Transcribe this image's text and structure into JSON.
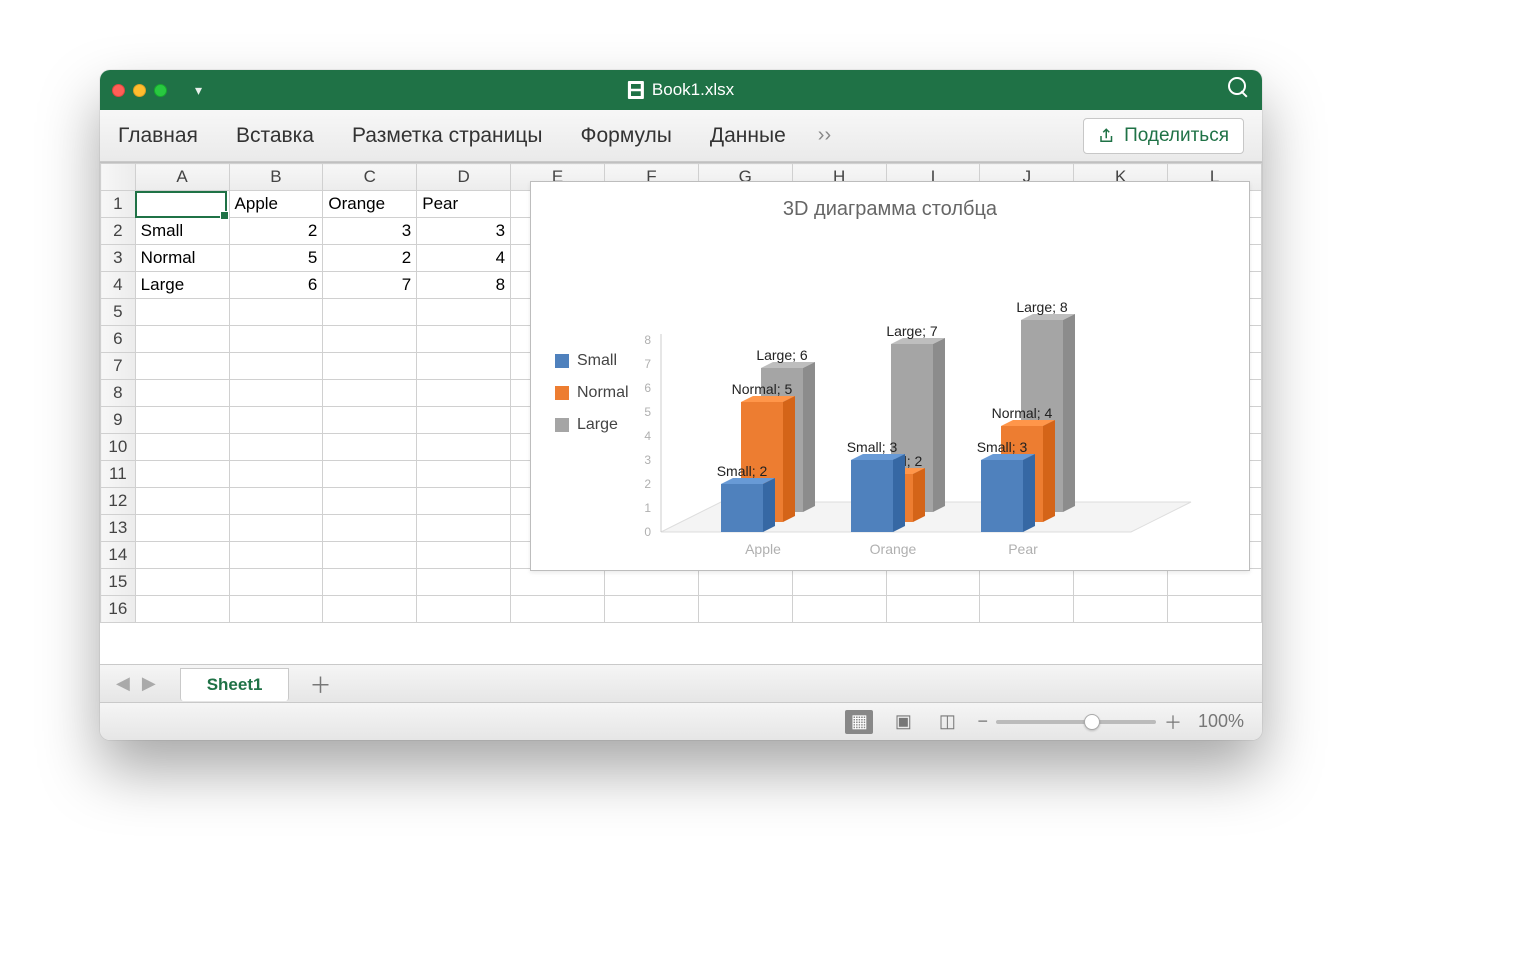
{
  "window": {
    "title": "Book1.xlsx"
  },
  "ribbon": {
    "home": "Главная",
    "insert": "Вставка",
    "layout": "Разметка страницы",
    "formulas": "Формулы",
    "data": "Данные",
    "more": "››",
    "share": "Поделиться"
  },
  "columns": [
    "A",
    "B",
    "C",
    "D",
    "E",
    "F",
    "G",
    "H",
    "I",
    "J",
    "K",
    "L"
  ],
  "rows": [
    "1",
    "2",
    "3",
    "4",
    "5",
    "6",
    "7",
    "8",
    "9",
    "10",
    "11",
    "12",
    "13",
    "14",
    "15",
    "16"
  ],
  "cells": {
    "B1": "Apple",
    "C1": "Orange",
    "D1": "Pear",
    "A2": "Small",
    "B2": "2",
    "C2": "3",
    "D2": "3",
    "A3": "Normal",
    "B3": "5",
    "C3": "2",
    "D3": "4",
    "A4": "Large",
    "B4": "6",
    "C4": "7",
    "D4": "8"
  },
  "chart": {
    "title": "3D диаграмма столбца",
    "legend": [
      "Small",
      "Normal",
      "Large"
    ]
  },
  "chart_data": {
    "type": "bar",
    "categories": [
      "Apple",
      "Orange",
      "Pear"
    ],
    "series": [
      {
        "name": "Small",
        "values": [
          2,
          3,
          3
        ],
        "color": "#4f81bd"
      },
      {
        "name": "Normal",
        "values": [
          5,
          2,
          4
        ],
        "color": "#ed7d31"
      },
      {
        "name": "Large",
        "values": [
          6,
          7,
          8
        ],
        "color": "#a5a5a5"
      }
    ],
    "ylim": [
      0,
      8
    ],
    "yticks": [
      0,
      1,
      2,
      3,
      4,
      5,
      6,
      7,
      8
    ],
    "title": "3D диаграмма столбца",
    "xlabel": "",
    "ylabel": ""
  },
  "sheettabs": {
    "active": "Sheet1"
  },
  "statusbar": {
    "zoom": "100%"
  }
}
